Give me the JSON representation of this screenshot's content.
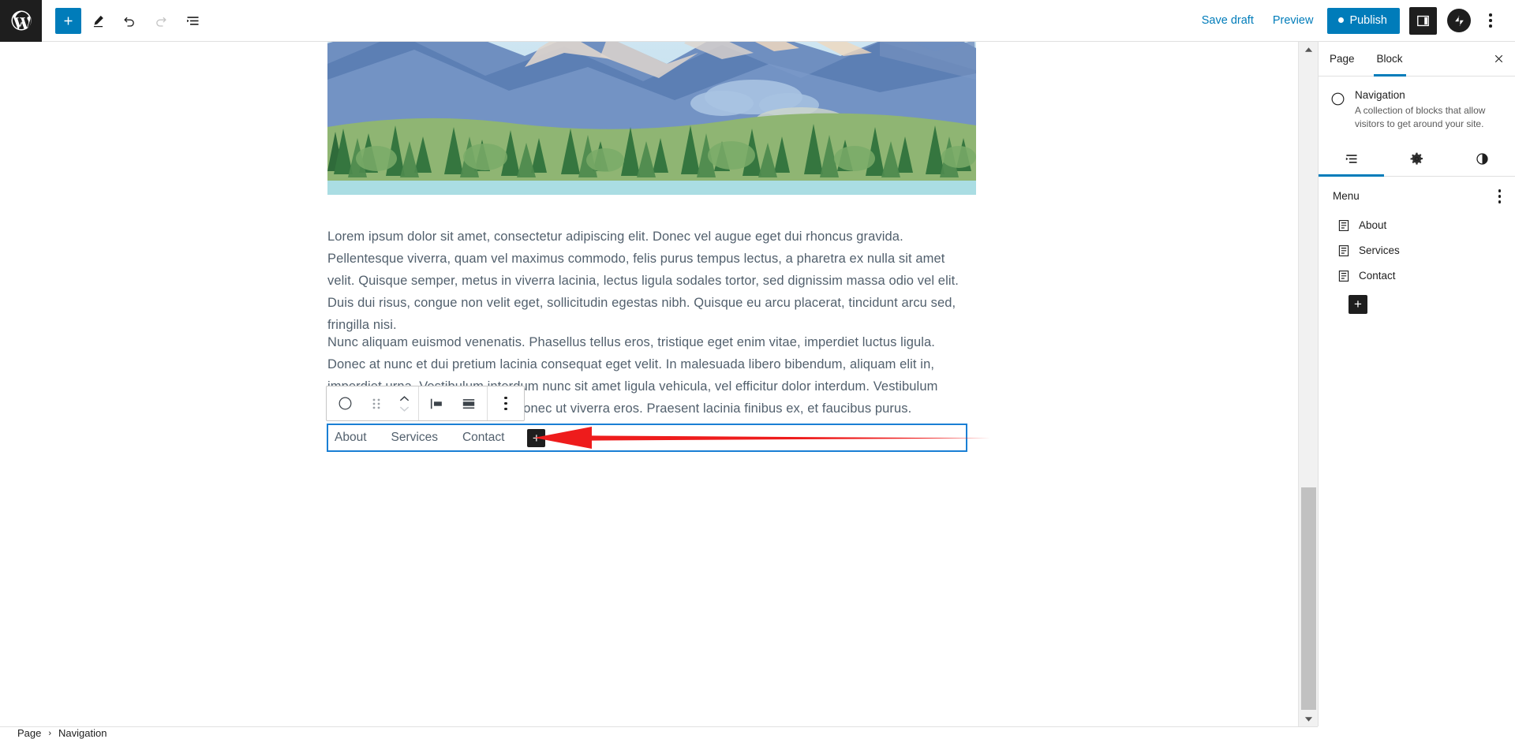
{
  "app": {
    "logo_icon": "wordpress-logo",
    "toolbar": {
      "add_block_icon": "plus-icon",
      "tools_icon": "pencil-icon",
      "undo_icon": "undo-arrow-icon",
      "redo_icon": "redo-arrow-icon",
      "list_view_icon": "document-overview-icon"
    },
    "actions": {
      "save_draft": "Save draft",
      "preview": "Preview",
      "publish": "Publish",
      "settings_icon": "sidebar-panel-icon",
      "avatar_icon": "jetpack-avatar-icon",
      "more_icon": "three-dots-vertical-icon"
    }
  },
  "content": {
    "image_alt": "mountain-forest-lake-illustration",
    "paragraph_1": "Lorem ipsum dolor sit amet, consectetur adipiscing elit. Donec vel augue eget dui rhoncus gravida. Pellentesque viverra, quam vel maximus commodo, felis purus tempus lectus, a pharetra ex nulla sit amet velit. Quisque semper, metus in viverra lacinia, lectus ligula sodales tortor, sed dignissim massa odio vel elit. Duis dui risus, congue non velit eget, sollicitudin egestas nibh. Quisque eu arcu placerat, tincidunt arcu sed, fringilla nisi.",
    "paragraph_2": "Nunc aliquam euismod venenatis. Phasellus tellus eros, tristique eget enim vitae, imperdiet luctus ligula. Donec at nunc et dui pretium lacinia consequat eget velit. In malesuada libero bibendum, aliquam elit in, imperdiet urna. Vestibulum interdum nunc sit amet ligula vehicula, vel efficitur dolor interdum. Vestibulum posuere nisi ac cursus suscipit. Donec ut viverra eros. Praesent lacinia finibus ex, et faucibus purus.",
    "navigation_block": {
      "links": [
        "About",
        "Services",
        "Contact"
      ],
      "add_label": "+",
      "selected_border_color": "#1a7fd4"
    }
  },
  "block_toolbar": {
    "block_type_icon": "navigation-compass-icon",
    "drag_icon": "drag-handle-icon",
    "move_up_icon": "chevron-up-icon",
    "move_down_icon": "chevron-down-icon",
    "justify_icon": "justify-items-left-icon",
    "layout_icon": "stack-layout-icon",
    "options_icon": "three-dots-vertical-icon"
  },
  "sidebar": {
    "tabs": [
      {
        "label": "Page",
        "active": false
      },
      {
        "label": "Block",
        "active": true
      }
    ],
    "close_icon": "close-x-icon",
    "block_info": {
      "icon": "navigation-compass-icon",
      "title": "Navigation",
      "description": "A collection of blocks that allow visitors to get around your site."
    },
    "icon_tabs": [
      {
        "icon": "list-view-icon",
        "active": true
      },
      {
        "icon": "gear-icon",
        "active": false
      },
      {
        "icon": "styles-contrast-icon",
        "active": false
      }
    ],
    "menu": {
      "label": "Menu",
      "options_icon": "three-dots-vertical-icon",
      "items": [
        {
          "icon": "page-icon",
          "label": "About"
        },
        {
          "icon": "page-icon",
          "label": "Services"
        },
        {
          "icon": "page-icon",
          "label": "Contact"
        }
      ],
      "add_label": "+"
    }
  },
  "breadcrumb": {
    "items": [
      "Page",
      "Navigation"
    ],
    "separator": "›"
  },
  "annotation": {
    "arrow_color": "#ee1c1c",
    "points_at": "navigation-block-add-button"
  },
  "colors": {
    "accent": "#007cba",
    "dark": "#1e1e1e",
    "text": "#52606d",
    "selection": "#1a7fd4"
  },
  "scrollbar": {
    "up_icon": "scroll-up-arrow",
    "down_icon": "scroll-down-arrow"
  }
}
